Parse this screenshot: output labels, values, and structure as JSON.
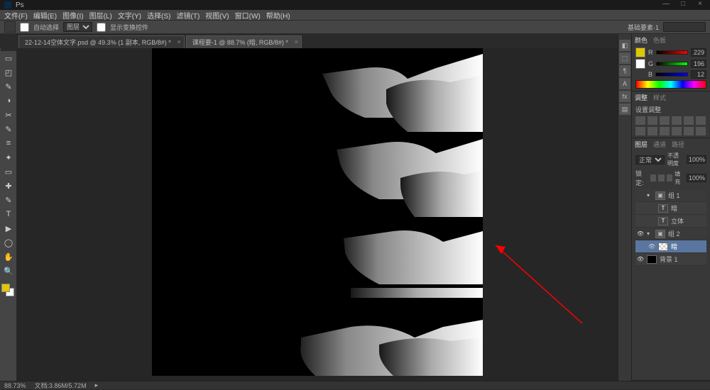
{
  "window": {
    "title": "Ps"
  },
  "menu": [
    "文件(F)",
    "编辑(E)",
    "图像(I)",
    "图层(L)",
    "文字(Y)",
    "选择(S)",
    "滤镜(T)",
    "视图(V)",
    "窗口(W)",
    "帮助(H)"
  ],
  "options": {
    "tool_icon": "move-tool",
    "auto_select_label": "自动选择",
    "auto_select_checked": false,
    "dropdown": "图层",
    "show_transform_label": "显示变换控件",
    "show_transform_checked": false,
    "right_label": "基础要素·1"
  },
  "tabs": [
    {
      "text": "22-12-14空体文字.psd @ 49.3% (1 副本, RGB/8#) *",
      "active": false
    },
    {
      "text": "课程要-1 @ 88.7% (暗, RGB/8#) *",
      "active": true
    }
  ],
  "tools": [
    "↔",
    "▭",
    "◰",
    "✎",
    "◑",
    "✂",
    "✎",
    "≡",
    "✦",
    "▭",
    "✚",
    "✎",
    "T",
    "▶",
    "◯",
    "✋",
    "🔍"
  ],
  "dock_mid": [
    "◧",
    "⬚",
    "¶",
    "A",
    "fx",
    "▤"
  ],
  "color_panel": {
    "tabs": [
      "颜色",
      "色板"
    ],
    "r": "229",
    "g": "196",
    "b": "12"
  },
  "adjust_panel": {
    "tabs": [
      "调整",
      "样式"
    ],
    "label": "设置调整"
  },
  "layers_panel": {
    "tabs": [
      "图层",
      "通道",
      "路径"
    ],
    "blend": "正常",
    "opacity_label": "不透明度",
    "opacity": "100%",
    "lock_label": "锁定:",
    "fill_label": "填充",
    "fill": "100%",
    "rows": [
      {
        "type": "group",
        "name": "组 1",
        "eye": false,
        "expanded": true
      },
      {
        "type": "text",
        "name": "暗",
        "eye": false,
        "indent": true
      },
      {
        "type": "text",
        "name": "立体",
        "eye": false,
        "indent": true
      },
      {
        "type": "group",
        "name": "组 2",
        "eye": true,
        "expanded": true
      },
      {
        "type": "layer",
        "name": "暗",
        "eye": true,
        "indent": true,
        "selected": true,
        "thumb": "checker"
      },
      {
        "type": "bg",
        "name": "背景 1",
        "eye": true,
        "thumb": "black"
      }
    ]
  },
  "status": {
    "zoom": "88.73%",
    "docinfo": "文档:3.86M/5.72M"
  }
}
